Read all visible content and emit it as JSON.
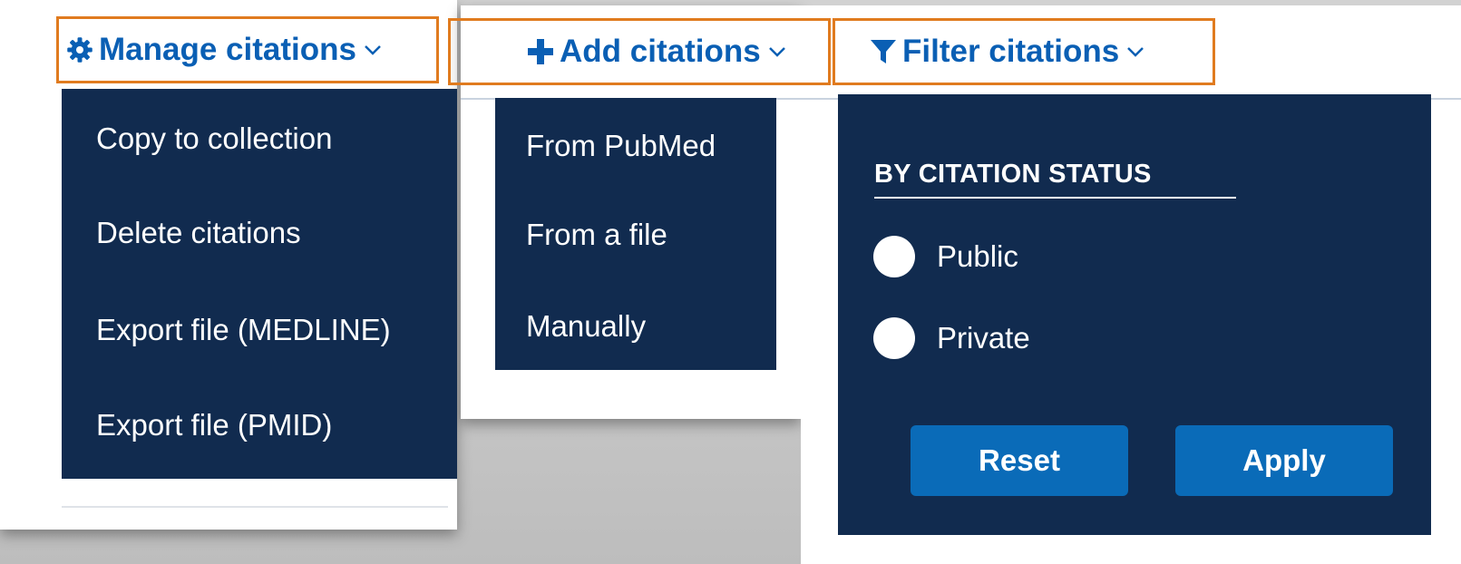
{
  "manage": {
    "label": "Manage citations",
    "items": [
      "Copy to collection",
      "Delete citations",
      "Export file (MEDLINE)",
      "Export file (PMID)"
    ]
  },
  "add": {
    "label": "Add citations",
    "items": [
      "From PubMed",
      "From a file",
      "Manually"
    ]
  },
  "filter": {
    "label": "Filter citations",
    "section_title": "BY CITATION STATUS",
    "options": [
      "Public",
      "Private"
    ],
    "reset_label": "Reset",
    "apply_label": "Apply"
  },
  "colors": {
    "link_blue": "#0a5fb4",
    "menu_navy": "#112b4f",
    "button_blue": "#0a6bb8",
    "highlight_orange": "#e07b1f"
  },
  "icons": {
    "manage": "gear-icon",
    "add": "plus-icon",
    "filter": "funnel-icon",
    "toggle": "chevron-down-icon"
  }
}
